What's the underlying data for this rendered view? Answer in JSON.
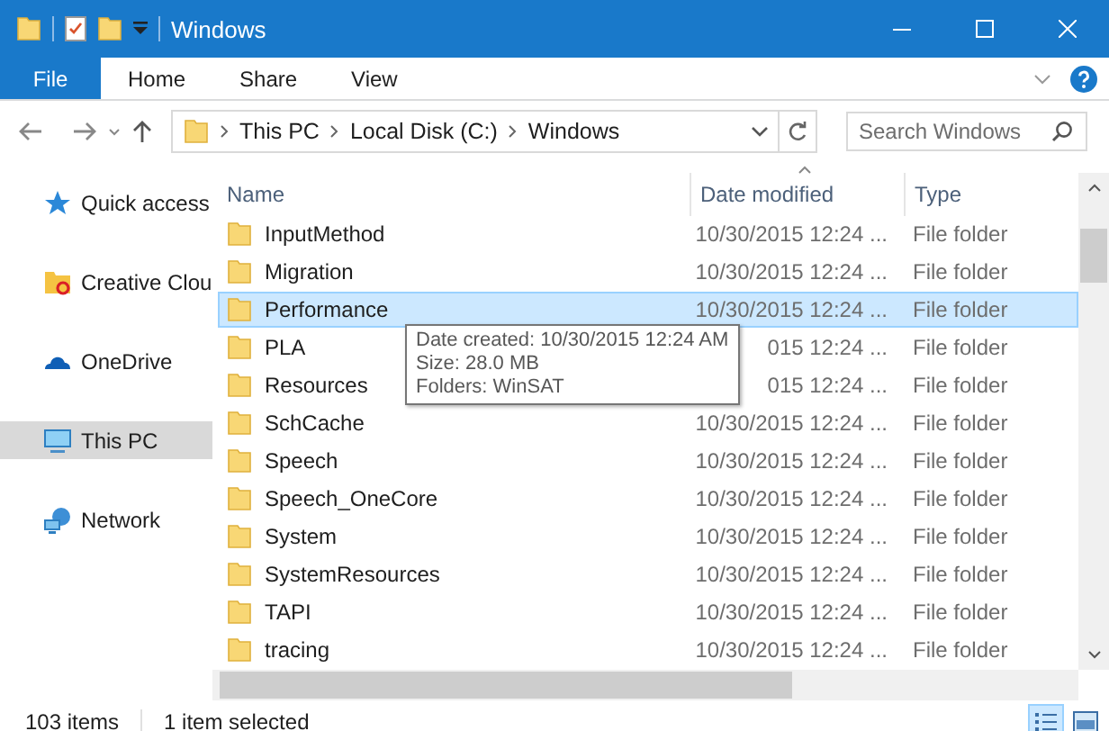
{
  "window": {
    "title": "Windows"
  },
  "ribbon": {
    "file_tab": "File",
    "tabs": [
      "Home",
      "Share",
      "View"
    ]
  },
  "address": {
    "path": [
      "This PC",
      "Local Disk (C:)",
      "Windows"
    ]
  },
  "search": {
    "placeholder": "Search Windows"
  },
  "sidebar": {
    "items": [
      {
        "label": "Quick access",
        "kind": "quick",
        "selected": false
      },
      {
        "label": "Creative Clou",
        "kind": "cloudfolder",
        "selected": false
      },
      {
        "label": "OneDrive",
        "kind": "onedrive",
        "selected": false
      },
      {
        "label": "This PC",
        "kind": "pc",
        "selected": true
      },
      {
        "label": "Network",
        "kind": "network",
        "selected": false
      }
    ]
  },
  "table": {
    "columns": [
      {
        "label": "Name",
        "sorted": false
      },
      {
        "label": "Date modified",
        "sorted": true
      },
      {
        "label": "Type",
        "sorted": false
      }
    ],
    "rows": [
      {
        "name": "InputMethod",
        "date": "10/30/2015 12:24 ...",
        "type": "File folder",
        "selected": false
      },
      {
        "name": "Migration",
        "date": "10/30/2015 12:24 ...",
        "type": "File folder",
        "selected": false
      },
      {
        "name": "Performance",
        "date": "10/30/2015 12:24 ...",
        "type": "File folder",
        "selected": true
      },
      {
        "name": "PLA",
        "date": "015 12:24 ...",
        "type": "File folder",
        "selected": false
      },
      {
        "name": "Resources",
        "date": "015 12:24 ...",
        "type": "File folder",
        "selected": false
      },
      {
        "name": "SchCache",
        "date": "10/30/2015 12:24 ...",
        "type": "File folder",
        "selected": false
      },
      {
        "name": "Speech",
        "date": "10/30/2015 12:24 ...",
        "type": "File folder",
        "selected": false
      },
      {
        "name": "Speech_OneCore",
        "date": "10/30/2015 12:24 ...",
        "type": "File folder",
        "selected": false
      },
      {
        "name": "System",
        "date": "10/30/2015 12:24 ...",
        "type": "File folder",
        "selected": false
      },
      {
        "name": "SystemResources",
        "date": "10/30/2015 12:24 ...",
        "type": "File folder",
        "selected": false
      },
      {
        "name": "TAPI",
        "date": "10/30/2015 12:24 ...",
        "type": "File folder",
        "selected": false
      },
      {
        "name": "tracing",
        "date": "10/30/2015 12:24 ...",
        "type": "File folder",
        "selected": false
      }
    ]
  },
  "tooltip": {
    "lines": [
      "Date created: 10/30/2015 12:24 AM",
      "Size: 28.0 MB",
      "Folders: WinSAT"
    ]
  },
  "status_bar": {
    "item_count": "103 items",
    "selection": "1 item selected",
    "views": [
      {
        "kind": "details",
        "selected": true
      },
      {
        "kind": "tiles",
        "selected": false
      }
    ]
  }
}
